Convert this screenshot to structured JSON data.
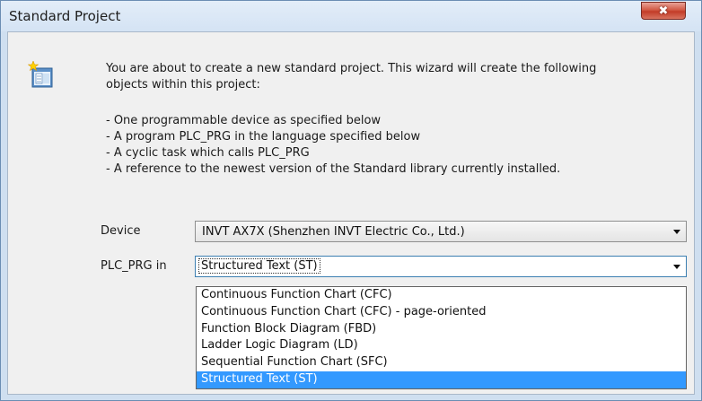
{
  "window": {
    "title": "Standard Project",
    "close_glyph": "✖"
  },
  "description": {
    "intro_line1": "You are about to create a new standard project. This wizard will create the following",
    "intro_line2": "objects within this project:",
    "bullets": [
      "- One programmable device as specified below",
      "- A program PLC_PRG in the language specified below",
      "- A cyclic task which calls PLC_PRG",
      "- A reference to the newest version of the Standard library currently installed."
    ]
  },
  "device": {
    "label": "Device",
    "value": "INVT AX7X (Shenzhen INVT Electric Co., Ltd.)"
  },
  "plc_prg": {
    "label": "PLC_PRG in",
    "value": "Structured Text (ST)",
    "options": [
      "Continuous Function Chart (CFC)",
      "Continuous Function Chart (CFC) - page-oriented",
      "Function Block Diagram (FBD)",
      "Ladder Logic Diagram (LD)",
      "Sequential Function Chart (SFC)",
      "Structured Text (ST)"
    ],
    "selected_index": 5
  },
  "colors": {
    "selection_highlight": "#3399ff",
    "close_button": "#c8442f",
    "title_bar": "#dbe8f6"
  },
  "icons": {
    "wizard": "new-project-wizard-icon",
    "close": "close-icon",
    "dropdown_arrow": "chevron-down-icon"
  }
}
